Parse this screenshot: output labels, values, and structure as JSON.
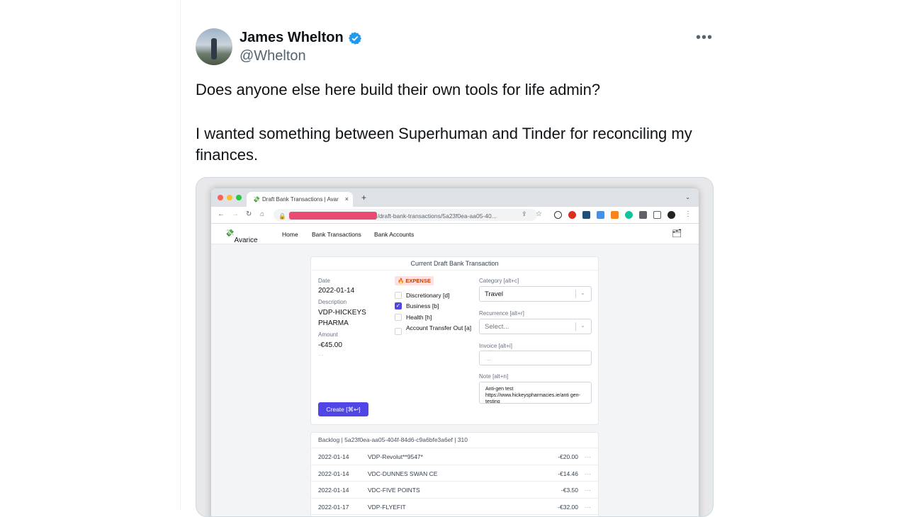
{
  "tweet": {
    "author_name": "James Whelton",
    "handle": "@Whelton",
    "more": "•••",
    "paragraph1": "Does anyone else here build their own tools for life admin?",
    "paragraph2": "I wanted something between Superhuman and Tinder for reconciling my finances."
  },
  "browser": {
    "tab_title": "Draft Bank Transactions | Avar",
    "url_suffix": "/draft-bank-transactions/5a23f0ea-aa05-40..."
  },
  "app": {
    "brand": "Avarice",
    "nav": [
      "Home",
      "Bank Transactions",
      "Bank Accounts"
    ],
    "card_title": "Current Draft Bank Transaction",
    "date_label": "Date",
    "date": "2022-01-14",
    "description_label": "Description",
    "description": "VDP-HICKEYS PHARMA",
    "amount_label": "Amount",
    "amount": "-€45.00",
    "ellipsis": "···",
    "type_badge": "🔥 EXPENSE",
    "checkboxes": [
      {
        "label": "Discretionary [d]",
        "checked": false
      },
      {
        "label": "Business [b]",
        "checked": true
      },
      {
        "label": "Health [h]",
        "checked": false
      },
      {
        "label": "Account Transfer Out [a]",
        "checked": false
      }
    ],
    "category_label": "Category [alt+c]",
    "category_value": "Travel",
    "recurrence_label": "Recurrence [alt+r]",
    "recurrence_placeholder": "Select...",
    "invoice_label": "Invoice [alt+i]",
    "invoice_placeholder": "....",
    "note_label": "Note [alt+n]",
    "note_value": "Anti-gen test https://www.hickeyspharmacies.ie/anti gen-testing",
    "create_button": "Create [⌘↩]",
    "backlog_title": "Backlog | 5a23f0ea-aa05-404f-84d6-c9a6bfe3a6ef | 310",
    "backlog": [
      {
        "date": "2022-01-14",
        "desc": "VDP-Revolut**9547*",
        "amount": "-€20.00"
      },
      {
        "date": "2022-01-14",
        "desc": "VDC-DUNNES SWAN CE",
        "amount": "-€14.46"
      },
      {
        "date": "2022-01-14",
        "desc": "VDC-FIVE POINTS",
        "amount": "-€3.50"
      },
      {
        "date": "2022-01-17",
        "desc": "VDP-FLYEFIT",
        "amount": "-€32.00"
      }
    ]
  }
}
